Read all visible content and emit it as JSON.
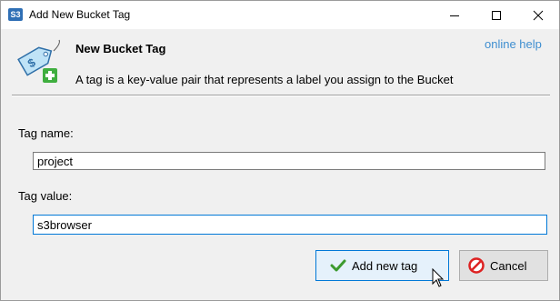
{
  "window": {
    "title": "Add New Bucket Tag",
    "app_icon_text": "S3"
  },
  "header": {
    "heading": "New Bucket Tag",
    "description": "A tag is a key-value pair that represents a label you assign to the Bucket",
    "help_link": "online help"
  },
  "form": {
    "tag_name_label": "Tag name:",
    "tag_name_value": "project",
    "tag_value_label": "Tag value:",
    "tag_value_value": "s3browser"
  },
  "buttons": {
    "add_label": "Add new tag",
    "cancel_label": "Cancel"
  },
  "colors": {
    "accent": "#0078d7",
    "link": "#3e8ed0"
  }
}
